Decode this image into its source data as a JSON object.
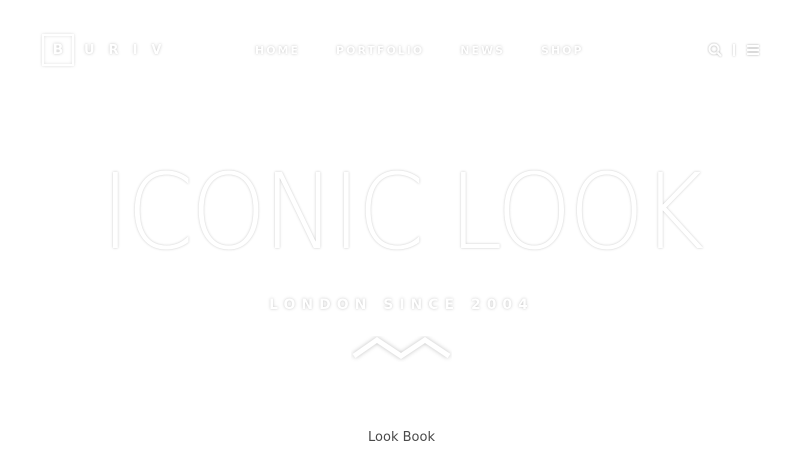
{
  "header": {
    "logo_mark": "B",
    "logo_text": "URIV",
    "nav": [
      {
        "label": "HOME"
      },
      {
        "label": "PORTFOLIO"
      },
      {
        "label": "NEWS"
      },
      {
        "label": "SHOP"
      }
    ],
    "icons": [
      "search-icon",
      "menu-icon"
    ]
  },
  "hero": {
    "title": "ICONIC LOOK",
    "subtitle": "LONDON SINCE 2004"
  },
  "footer": {
    "caption": "Look Book"
  },
  "colors": {
    "background": "#ffffff",
    "caption": "#4a4a4a"
  }
}
